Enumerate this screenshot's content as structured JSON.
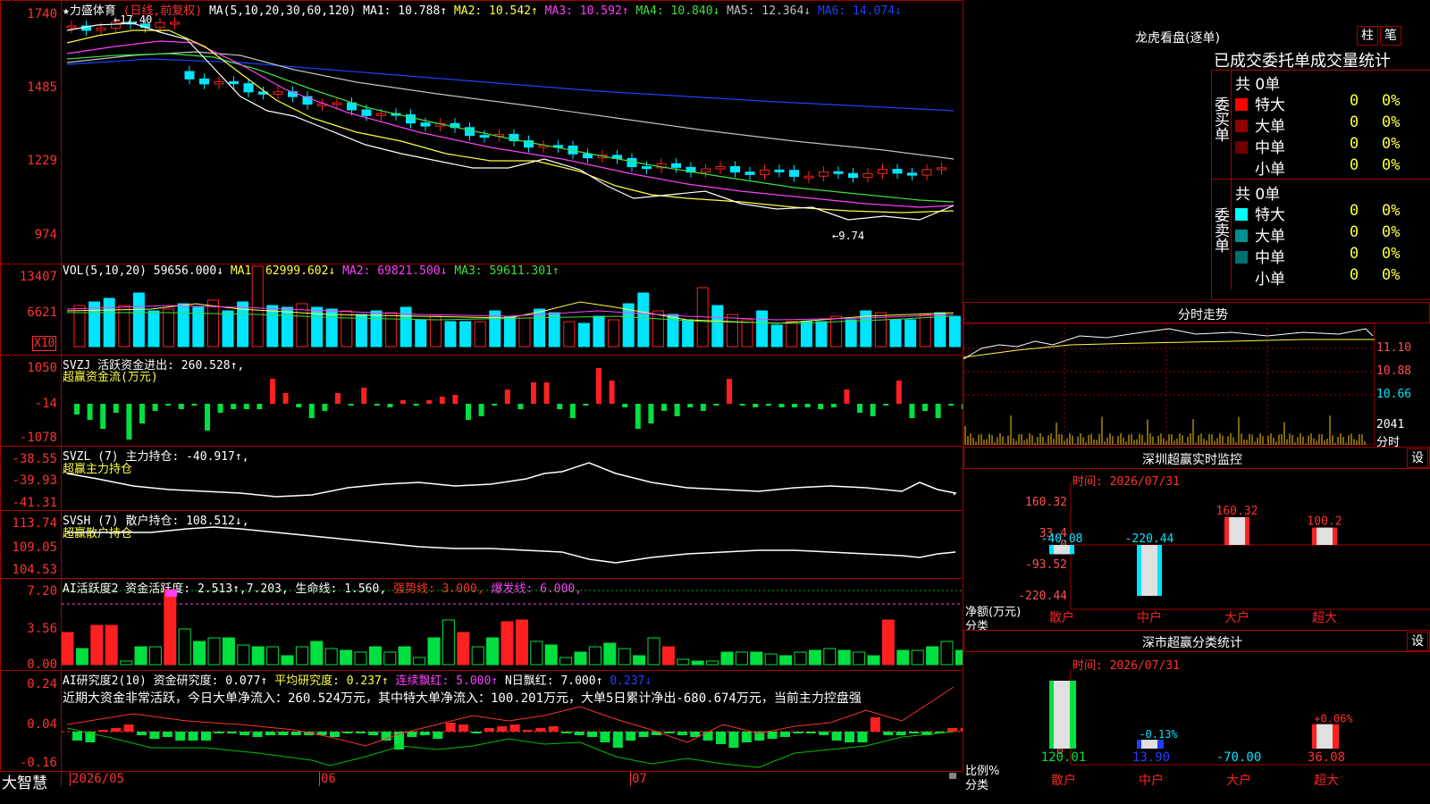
{
  "colors": {
    "up": "#ff2020",
    "down": "#00e5ff",
    "grid": "#a00000",
    "ma1": "#ffffff",
    "ma2": "#ffff40",
    "ma3": "#ff40ff",
    "ma4": "#40e040",
    "ma5": "#c0c0c0",
    "ma6": "#2040ff"
  },
  "header": {
    "stock": "★力盛体育",
    "period": "(日线,前复权)",
    "ma_label": "MA(5,10,20,30,60,120)",
    "ma1": "MA1: 10.788↑",
    "ma2": "MA2: 10.542↑",
    "ma3": "MA3: 10.592↑",
    "ma4": "MA4: 10.840↓",
    "ma5": "MA5: 12.364↓",
    "ma6": "MA6: 14.074↓",
    "high_mark": "←17.40",
    "low_mark": "←9.74"
  },
  "price_axis": [
    "1740",
    "1485",
    "1229",
    "974"
  ],
  "vol": {
    "title": "VOL(5,10,20)",
    "v": "59656.000↓",
    "ma1": "MA1: 62999.602↓",
    "ma2": "MA2: 69821.500↓",
    "ma3": "MA3: 59611.301↑",
    "axis": [
      "13407",
      "6621"
    ],
    "unit": "X10"
  },
  "svzj": {
    "title": "SVZJ 活跃资金进出: 260.528↑,",
    "subtitle": "超赢资金流(万元)",
    "axis": [
      "1050",
      "-14",
      "-1078"
    ]
  },
  "svzl": {
    "title": "SVZL (7) 主力持仓: -40.917↑,",
    "subtitle": "超赢主力持仓",
    "axis": [
      "-38.55",
      "-39.93",
      "-41.31"
    ]
  },
  "svsh": {
    "title": "SVSH (7) 散户持仓: 108.512↓,",
    "subtitle": "超赢散户持仓",
    "axis": [
      "113.74",
      "109.05",
      "104.53"
    ]
  },
  "ai_act": {
    "title": "AI活跃度2 资金活跃度: 2.513↑,7.203,",
    "life": "生命线: 1.560,",
    "strong": "强势线: 3.000,",
    "burst": "爆发线: 6.000,",
    "axis": [
      "7.20",
      "3.56",
      "0.00"
    ]
  },
  "ai_res": {
    "title": "AI研究度2(10) 资金研究度: 0.077↑",
    "avg": "平均研究度: 0.237↑",
    "cont": "连续飘红: 5.000↑",
    "n": "N日飘红: 7.000↑",
    "v": "0.237↓",
    "text": "近期大资金非常活跃，今日大单净流入：260.524万元，其中特大单净流入：100.201万元，大单5日累计净出-680.674万元，当前主力控盘强",
    "axis": [
      "0.24",
      "0.04",
      "-0.16"
    ]
  },
  "date_axis": [
    "2026/05",
    "06",
    "07"
  ],
  "brand": "大智慧",
  "dragon": {
    "title": "龙虎看盘(逐单)",
    "btn1": "柱",
    "btn2": "笔",
    "subtitle": "已成交委托单成交量统计",
    "buy": {
      "side": "委买单",
      "count": "共 0单",
      "rows": [
        {
          "label": "特大",
          "v": "0",
          "p": "0%",
          "c": "#ff0000"
        },
        {
          "label": "大单",
          "v": "0",
          "p": "0%",
          "c": "#900000"
        },
        {
          "label": "中单",
          "v": "0",
          "p": "0%",
          "c": "#700000"
        },
        {
          "label": "小单",
          "v": "0",
          "p": "0%",
          "c": ""
        }
      ]
    },
    "sell": {
      "side": "委卖单",
      "count": "共 0单",
      "rows": [
        {
          "label": "特大",
          "v": "0",
          "p": "0%",
          "c": "#00ffff"
        },
        {
          "label": "大单",
          "v": "0",
          "p": "0%",
          "c": "#009090"
        },
        {
          "label": "中单",
          "v": "0",
          "p": "0%",
          "c": "#007070"
        },
        {
          "label": "小单",
          "v": "0",
          "p": "0%",
          "c": ""
        }
      ]
    }
  },
  "intraday": {
    "title": "分时走势",
    "axis": [
      "11.10",
      "10.88",
      "10.66"
    ],
    "vol": "2041",
    "vol_unit": "分时"
  },
  "sz_monitor": {
    "title": "深圳超赢实时监控",
    "btn": "设",
    "time": "时间: 2026/07/31",
    "axis": [
      "160.32",
      "33.4",
      "0",
      "-93.52",
      "-220.44"
    ],
    "ylabel": "净额(万元)",
    "xlabel": "分类",
    "bars": [
      {
        "cat": "散户",
        "v": -40.08,
        "label": "-40.08"
      },
      {
        "cat": "中户",
        "v": -220.44,
        "label": "-220.44"
      },
      {
        "cat": "大户",
        "v": 160.32,
        "label": "160.32"
      },
      {
        "cat": "超大",
        "v": 100.2,
        "label": "100.2"
      }
    ]
  },
  "sz_class": {
    "title": "深市超赢分类统计",
    "btn": "设",
    "time": "时间: 2026/07/31",
    "axis": [
      "75",
      "50",
      "25",
      "0"
    ],
    "ylabel": "比例%",
    "xlabel": "分类",
    "bars": [
      {
        "cat": "散户",
        "pct": 100,
        "val": "120.01",
        "label": ""
      },
      {
        "cat": "中户",
        "pct": 13,
        "val": "13.90",
        "label": "-0.13%"
      },
      {
        "cat": "大户",
        "pct": 0,
        "val": "-70.00",
        "label": ""
      },
      {
        "cat": "超大",
        "pct": 36,
        "val": "36.08",
        "label": "+0.06%"
      }
    ]
  }
}
